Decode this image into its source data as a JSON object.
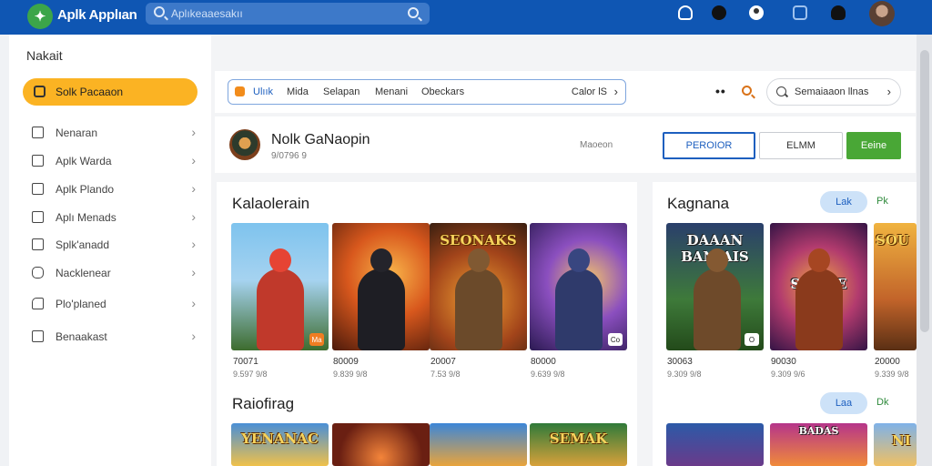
{
  "header": {
    "app_title": "Aplk Applıan",
    "search_placeholder": "Aplıkeaaesakıı",
    "colors": {
      "bar": "#0f56b3",
      "accent": "#fbb323",
      "primary": "#1d5fbf",
      "success": "#49a736"
    },
    "icons": [
      "leaf-logo-icon",
      "search-icon",
      "cloud-icon",
      "ninja-icon",
      "user-icon",
      "box-icon",
      "hat-icon",
      "avatar"
    ]
  },
  "sidebar": {
    "title": "Nakait",
    "active": {
      "label": "Solk Pacaaon",
      "icon": "bag-icon"
    },
    "items": [
      {
        "label": "Nenaran",
        "icon": "square-icon"
      },
      {
        "label": "Aplk Warda",
        "icon": "list-icon"
      },
      {
        "label": "Aplk Plando",
        "icon": "edit-icon"
      },
      {
        "label": "Aplı Menads",
        "icon": "edit-icon"
      },
      {
        "label": "Splk'anadd",
        "icon": "square-icon"
      },
      {
        "label": "Nacklenear",
        "icon": "chat-icon"
      },
      {
        "label": "Plo'planed",
        "icon": "tag-icon"
      },
      {
        "label": "Benaakast",
        "icon": "mail-icon"
      }
    ]
  },
  "toolbar": {
    "tabs": [
      "Ulıık",
      "Mida",
      "Selapan",
      "Menani",
      "Obeckars"
    ],
    "select_label": "Calor lS",
    "dots": "••",
    "search_label": "Semaiaaon llnas"
  },
  "profile": {
    "name": "Nolk GaNaopin",
    "sub": "9/0796 9",
    "mid_label": "Maoeon",
    "buttons": {
      "primary": "PEROIOR",
      "secondary": "ELMM",
      "success": "Eeine"
    }
  },
  "sections": {
    "left_top": {
      "title": "Kalaolerain",
      "cards": [
        {
          "num": "70071",
          "sub": "9.597 9/8",
          "badge": "Ma",
          "badge_style": "orange"
        },
        {
          "num": "80009",
          "sub": "9.839 9/8",
          "badge": "",
          "badge_style": "none"
        },
        {
          "num": "20007",
          "sub": "7.53 9/8",
          "badge": "",
          "badge_style": "none",
          "banner": "SEONAKS"
        },
        {
          "num": "80000",
          "sub": "9.639 9/8",
          "badge": "Co",
          "badge_style": "white"
        }
      ]
    },
    "right_top": {
      "title": "Kagnana",
      "pill": "Lak",
      "link": "Pk",
      "cards": [
        {
          "num": "30063",
          "sub": "9.309 9/8",
          "badge": "O",
          "badge_style": "white",
          "banner": "DAAAN BANIAIS"
        },
        {
          "num": "90030",
          "sub": "9.309 9/6",
          "badge": "",
          "badge_style": "none",
          "banner": "SOONE"
        },
        {
          "num": "20000",
          "sub": "9.339 9/8",
          "badge": "",
          "badge_style": "none",
          "banner": "SOU"
        }
      ]
    },
    "left_bottom": {
      "title": "Raiofirag",
      "cards": [
        {
          "banner": "YENANAC"
        },
        {
          "banner": ""
        },
        {
          "banner": ""
        },
        {
          "banner": "SEMAK"
        }
      ]
    },
    "right_bottom": {
      "pill": "Laa",
      "link": "Dk",
      "cards": [
        {
          "banner": ""
        },
        {
          "banner": "BADAS"
        },
        {
          "banner": "NI"
        }
      ]
    }
  }
}
